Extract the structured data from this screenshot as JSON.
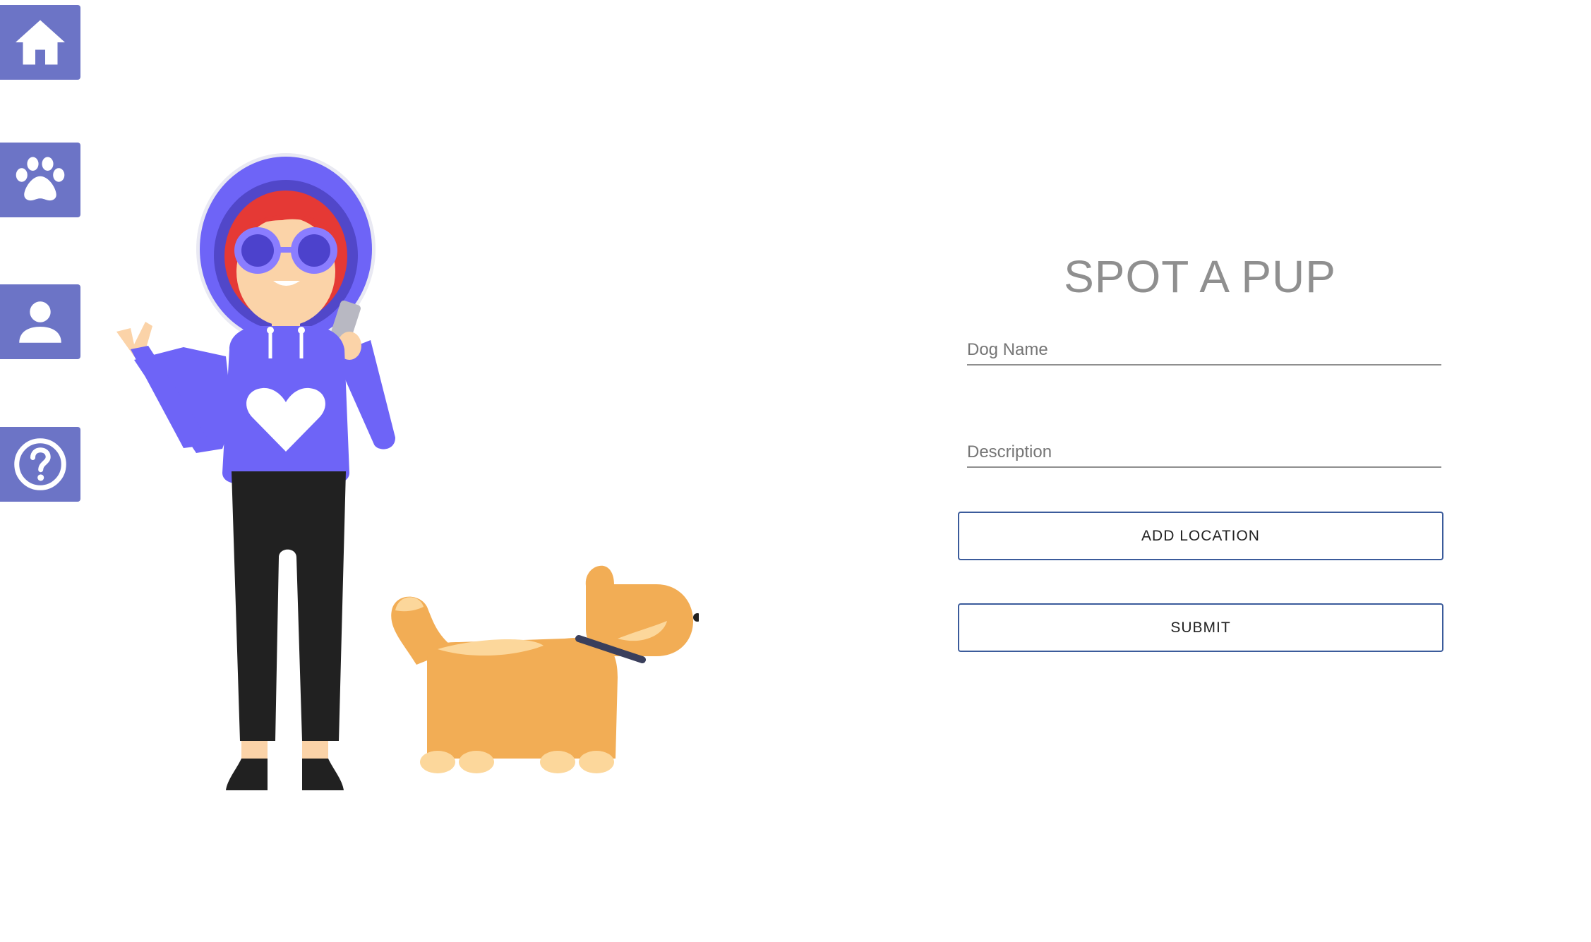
{
  "sidebar": {
    "items": [
      {
        "icon": "home-icon"
      },
      {
        "icon": "paw-icon"
      },
      {
        "icon": "user-icon"
      },
      {
        "icon": "help-icon"
      }
    ],
    "color": "#6c74c6"
  },
  "form": {
    "title": "SPOT A PUP",
    "dog_name_placeholder": "Dog Name",
    "description_placeholder": "Description",
    "add_location_label": "ADD LOCATION",
    "submit_label": "SUBMIT"
  },
  "colors": {
    "accent": "#6c74c6",
    "button_border": "#3b5b9b",
    "hoodie": "#6e64f7",
    "dog": "#f2ad55"
  }
}
